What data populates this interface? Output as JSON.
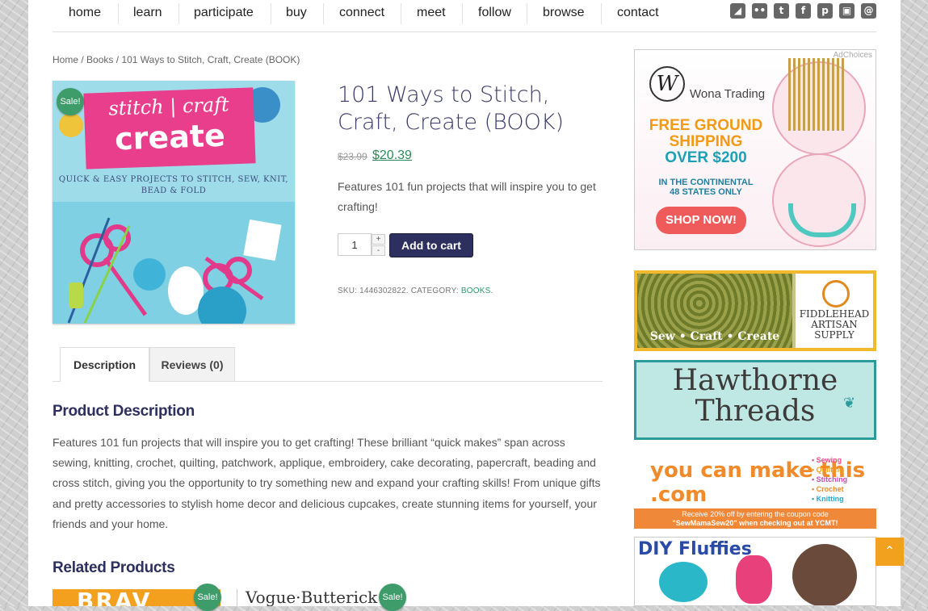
{
  "nav": {
    "items": [
      "home",
      "learn",
      "participate",
      "buy",
      "connect",
      "meet",
      "follow",
      "browse",
      "contact"
    ],
    "social_icons": [
      "rss-icon",
      "flickr-icon",
      "twitter-icon",
      "facebook-icon",
      "pinterest-icon",
      "instagram-icon",
      "email-icon"
    ]
  },
  "breadcrumb": {
    "home": "Home",
    "sep": "/",
    "category": "Books",
    "current": "101 Ways to Stitch, Craft, Create (BOOK)"
  },
  "product": {
    "sale_badge": "Sale!",
    "image_title_1": "stitch | craft",
    "image_title_2": "create",
    "image_subtitle": "QUICK & EASY PROJECTS TO STITCH, SEW, KNIT, BEAD & FOLD",
    "title": "101 Ways to Stitch, Craft, Create (BOOK)",
    "price_old": "$23.99",
    "price_new": "$20.39",
    "short_description": "Features 101 fun projects that will inspire you to get crafting!",
    "quantity": "1",
    "qty_up": "+",
    "qty_down": "-",
    "add_to_cart": "Add to cart",
    "sku_label": "SKU: 1446302822. CATEGORY: ",
    "category": "BOOKS",
    "category_end": "."
  },
  "tabs": {
    "description": "Description",
    "reviews": "Reviews (0)"
  },
  "description": {
    "heading": "Product Description",
    "body": "Features 101 fun projects that will inspire you to get crafting! These brilliant “quick makes” span across sewing, knitting, crochet, quilting, patchwork, applique, embroidery, cake decorating, papercraft, beading and cross stitch, giving you the opportunity to try something new and expand your crafting skills! From unique gifts and pretty accessories to stylish home decor and delicious cupcakes, create stunning items for yourself, your friends and your home."
  },
  "related": {
    "heading": "Related Products",
    "item1_text": "BRAV",
    "item2_text": "Vogue·Butterick",
    "sale_badge": "Sale!"
  },
  "ads": {
    "adchoices": "AdChoices",
    "wona_brand": "Wona Trading",
    "wona_line1": "FREE GROUND",
    "wona_line2": "SHIPPING",
    "wona_line3": "OVER $200",
    "wona_line4": "IN THE CONTINENTAL",
    "wona_line5": "48 STATES ONLY",
    "wona_cta": "SHOP NOW!",
    "fiddlehead_tag": "Sew • Craft • Create",
    "fiddlehead_name1": "FIDDLEHEAD",
    "fiddlehead_name2": "ARTISAN",
    "fiddlehead_name3": "SUPPLY",
    "hawthorne1": "Hawthorne",
    "hawthorne2": "Threads",
    "ycmt_logo": "you can make this .com",
    "ycmt_list": [
      "• Sewing",
      "• Quilting",
      "• Stitching",
      "• Crochet",
      "• Knitting"
    ],
    "ycmt_promo1": "Receive 20% off by entering the coupon code",
    "ycmt_promo2": "\"SewMamaSew20\" when checking out at YCMT!",
    "diy": "DIY Fluffies"
  },
  "colors": {
    "accent_navy": "#2d2f5e",
    "price_green": "#2f8a5a",
    "sale_green": "#3d9c6a",
    "scroll_orange": "#f2a11f"
  }
}
